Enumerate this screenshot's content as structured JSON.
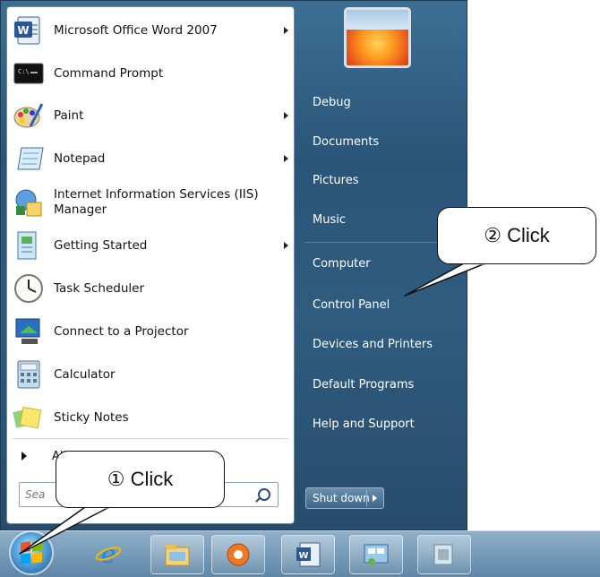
{
  "start_menu": {
    "programs": [
      {
        "label": "Microsoft Office Word 2007",
        "icon": "word-icon",
        "has_submenu": true
      },
      {
        "label": "Command Prompt",
        "icon": "command-prompt-icon",
        "has_submenu": false
      },
      {
        "label": "Paint",
        "icon": "paint-icon",
        "has_submenu": true
      },
      {
        "label": "Notepad",
        "icon": "notepad-icon",
        "has_submenu": true
      },
      {
        "label": "Internet Information Services (IIS) Manager",
        "icon": "iis-manager-icon",
        "has_submenu": false
      },
      {
        "label": "Getting Started",
        "icon": "getting-started-icon",
        "has_submenu": true
      },
      {
        "label": "Task Scheduler",
        "icon": "task-scheduler-icon",
        "has_submenu": false
      },
      {
        "label": "Connect to a Projector",
        "icon": "projector-icon",
        "has_submenu": false
      },
      {
        "label": "Calculator",
        "icon": "calculator-icon",
        "has_submenu": false
      },
      {
        "label": "Sticky Notes",
        "icon": "sticky-notes-icon",
        "has_submenu": false
      }
    ],
    "all_programs_label": "All",
    "search_placeholder": "Sea",
    "right_links": [
      "Debug",
      "Documents",
      "Pictures",
      "Music",
      "Computer",
      "Control Panel",
      "Devices and Printers",
      "Default Programs",
      "Help and Support"
    ],
    "shutdown_label": "Shut down"
  },
  "taskbar": {
    "items": [
      "start-orb",
      "internet-explorer-icon",
      "file-explorer-icon",
      "media-player-icon",
      "word-icon",
      "control-panel-icon",
      "app-icon"
    ]
  },
  "callouts": {
    "first": "① Click",
    "second": "② Click"
  }
}
